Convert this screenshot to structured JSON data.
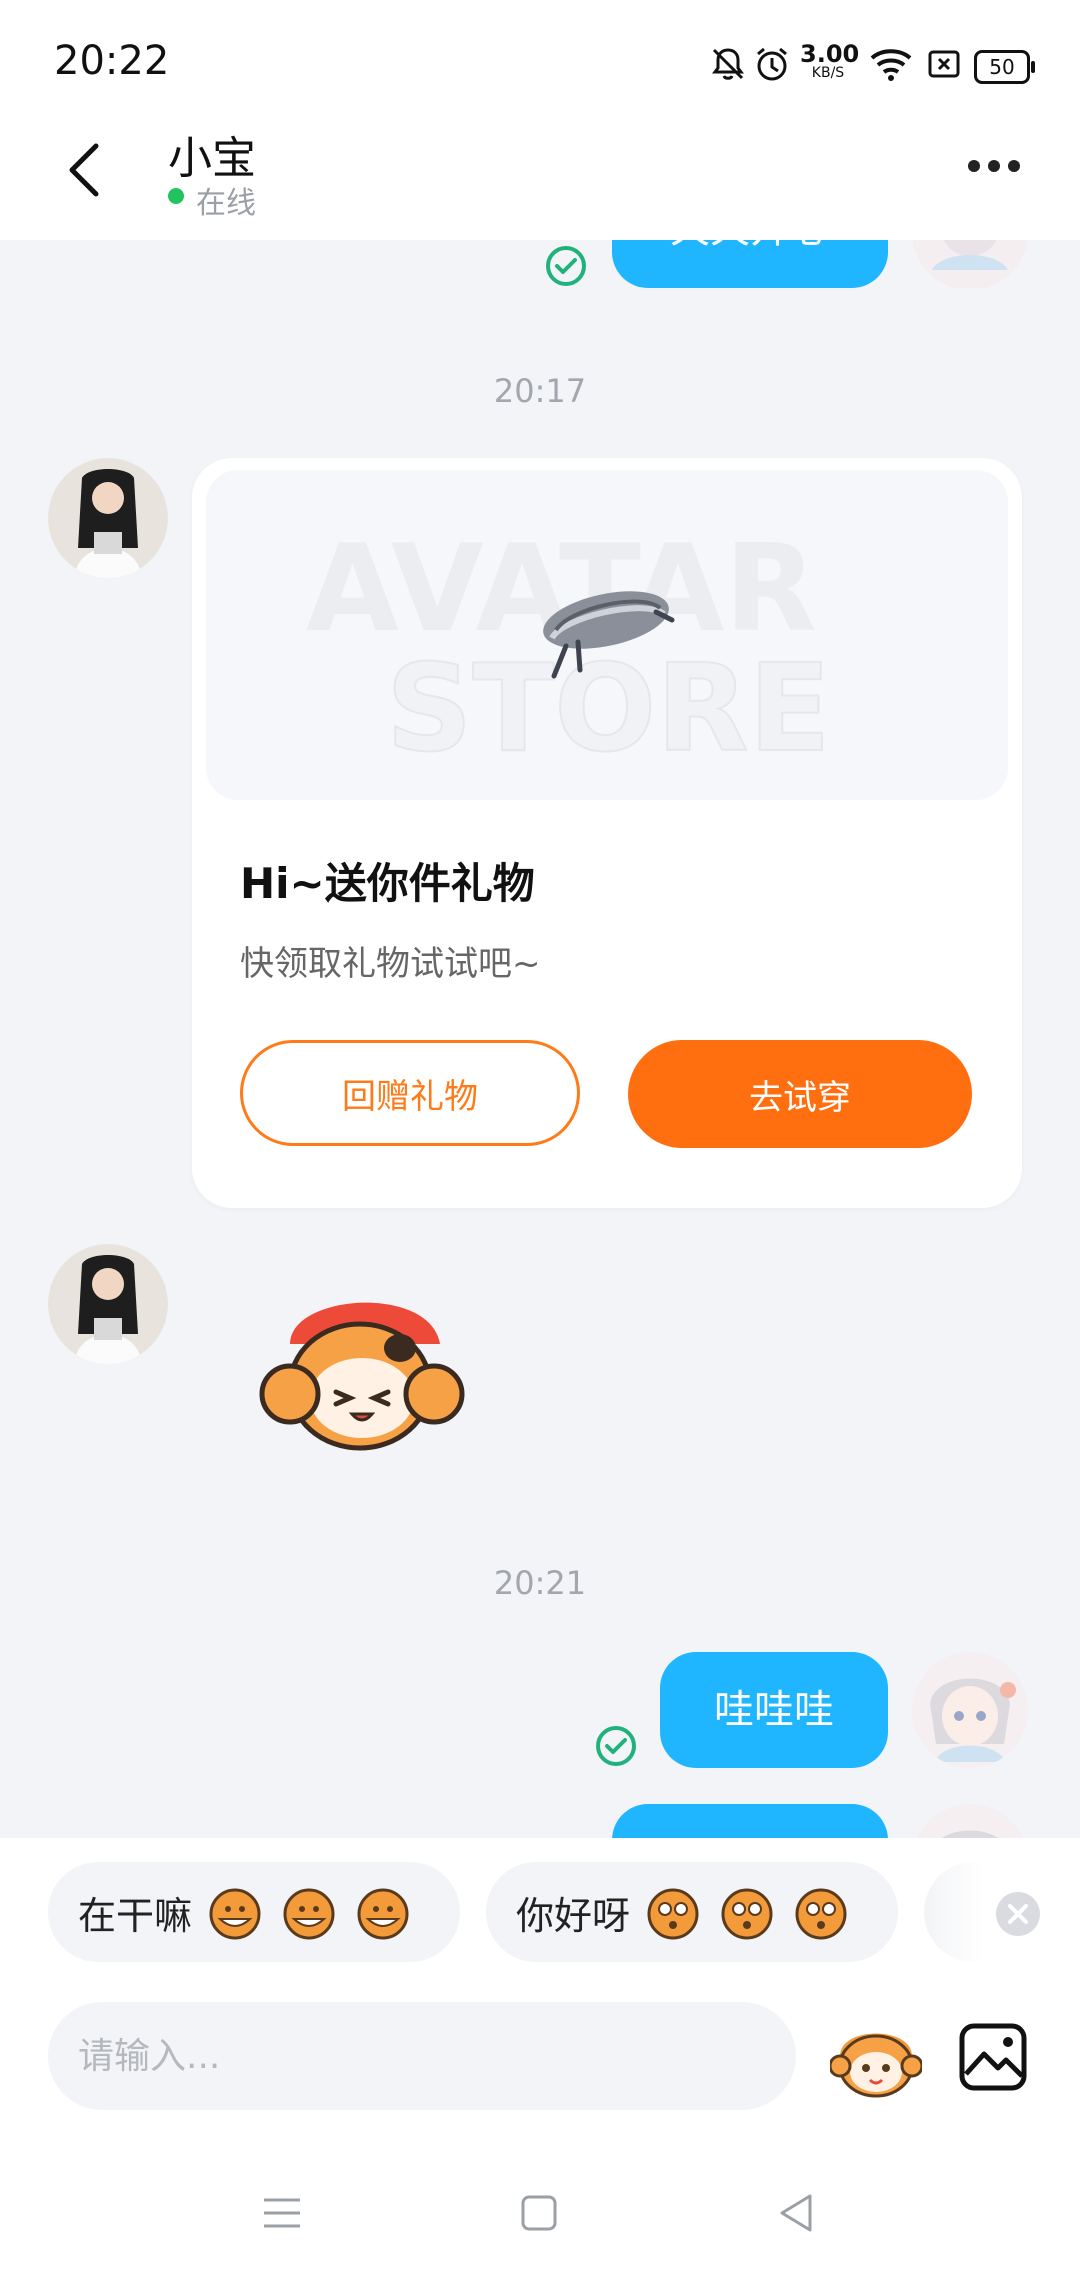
{
  "status_bar": {
    "time": "20:22",
    "net_speed_value": "3.00",
    "net_speed_unit": "KB/S",
    "battery": "50",
    "icons": [
      "mute-bell-icon",
      "alarm-icon",
      "wifi-icon",
      "sim-off-icon",
      "battery-icon"
    ]
  },
  "header": {
    "name": "小宝",
    "status": "在线",
    "status_color": "#21c45d"
  },
  "messages": {
    "top_partial_text": "天天开心",
    "timestamp_1": "20:17",
    "gift": {
      "title": "Hi~送你件礼物",
      "subtitle": "快领取礼物试试吧~",
      "return_button": "回赠礼物",
      "try_button": "去试穿",
      "watermark_line1": "AVATAR",
      "watermark_line2": "STORE"
    },
    "timestamp_2": "20:21",
    "outgoing_1": "哇哇哇"
  },
  "quick_replies": [
    {
      "text": "在干嘛"
    },
    {
      "text": "你好呀"
    }
  ],
  "input": {
    "placeholder": "请输入..."
  },
  "colors": {
    "accent_blue": "#1fb5ff",
    "accent_orange": "#ff6f0f",
    "background": "#f2f4f8"
  }
}
